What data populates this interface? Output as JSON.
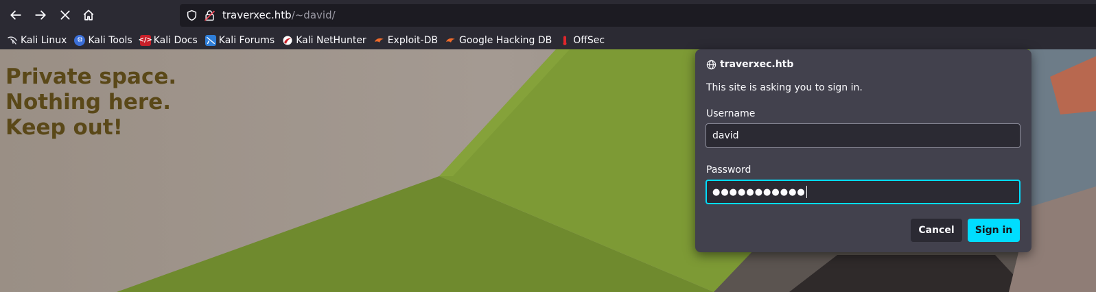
{
  "toolbar": {
    "url_host": "traverxec.htb",
    "url_path": "/~david/"
  },
  "bookmarks": [
    {
      "label": "Kali Linux",
      "icon": "kali-dragon-icon"
    },
    {
      "label": "Kali Tools",
      "icon": "kali-tools-icon"
    },
    {
      "label": "Kali Docs",
      "icon": "kali-docs-icon"
    },
    {
      "label": "Kali Forums",
      "icon": "kali-forums-icon"
    },
    {
      "label": "Kali NetHunter",
      "icon": "kali-nethunter-icon"
    },
    {
      "label": "Exploit-DB",
      "icon": "exploit-db-icon"
    },
    {
      "label": "Google Hacking DB",
      "icon": "ghdb-icon"
    },
    {
      "label": "OffSec",
      "icon": "offsec-icon"
    }
  ],
  "page": {
    "heading_line1": "Private space.",
    "heading_line2": "Nothing here.",
    "heading_line3": "Keep out!"
  },
  "dialog": {
    "host": "traverxec.htb",
    "message": "This site is asking you to sign in.",
    "username_label": "Username",
    "username_value": "david",
    "password_label": "Password",
    "password_value": "●●●●●●●●●●●",
    "cancel_label": "Cancel",
    "signin_label": "Sign in"
  },
  "colors": {
    "accent": "#00ddff",
    "toolbar_bg": "#2b2a33",
    "dialog_bg": "#42414d",
    "heading": "#5a4818"
  }
}
